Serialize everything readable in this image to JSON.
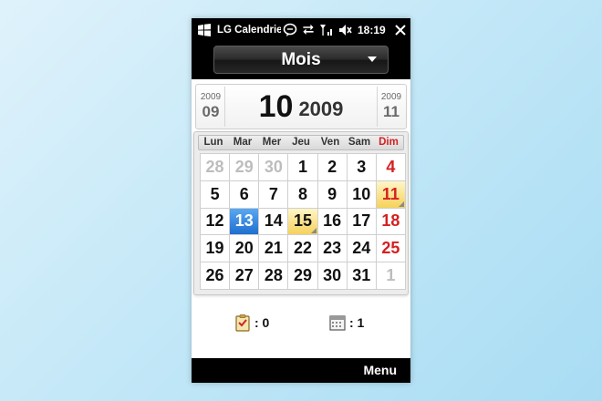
{
  "status_bar": {
    "app_title": "LG Calendrier",
    "time": "18:19",
    "icons": [
      "windows-logo-icon",
      "chat-bubble-icon",
      "data-sync-icon",
      "signal-icon",
      "speaker-muted-icon",
      "close-icon"
    ]
  },
  "view_selector": {
    "label": "Mois"
  },
  "month_nav": {
    "prev": {
      "year": "2009",
      "month": "09"
    },
    "current": {
      "month": "10",
      "year": "2009"
    },
    "next": {
      "year": "2009",
      "month": "11"
    }
  },
  "weekdays": [
    "Lun",
    "Mar",
    "Mer",
    "Jeu",
    "Ven",
    "Sam",
    "Dim"
  ],
  "weeks": [
    [
      {
        "d": "28",
        "out": true
      },
      {
        "d": "29",
        "out": true
      },
      {
        "d": "30",
        "out": true
      },
      {
        "d": "1"
      },
      {
        "d": "2"
      },
      {
        "d": "3"
      },
      {
        "d": "4"
      }
    ],
    [
      {
        "d": "5"
      },
      {
        "d": "6"
      },
      {
        "d": "7"
      },
      {
        "d": "8"
      },
      {
        "d": "9"
      },
      {
        "d": "10"
      },
      {
        "d": "11",
        "event": true
      }
    ],
    [
      {
        "d": "12"
      },
      {
        "d": "13",
        "today": true
      },
      {
        "d": "14"
      },
      {
        "d": "15",
        "event": true
      },
      {
        "d": "16"
      },
      {
        "d": "17"
      },
      {
        "d": "18"
      }
    ],
    [
      {
        "d": "19"
      },
      {
        "d": "20"
      },
      {
        "d": "21"
      },
      {
        "d": "22"
      },
      {
        "d": "23"
      },
      {
        "d": "24"
      },
      {
        "d": "25"
      }
    ],
    [
      {
        "d": "26"
      },
      {
        "d": "27"
      },
      {
        "d": "28"
      },
      {
        "d": "29"
      },
      {
        "d": "30"
      },
      {
        "d": "31"
      },
      {
        "d": "1",
        "out": true
      }
    ]
  ],
  "counters": {
    "tasks": {
      "icon": "task-clipboard-icon",
      "value": ": 0"
    },
    "events": {
      "icon": "calendar-icon",
      "value": ": 1"
    }
  },
  "softkey": {
    "right": "Menu"
  },
  "colors": {
    "sunday": "#d52020",
    "today": "#1f6fd0",
    "event": "#f6d25a",
    "bar": "#000000"
  }
}
